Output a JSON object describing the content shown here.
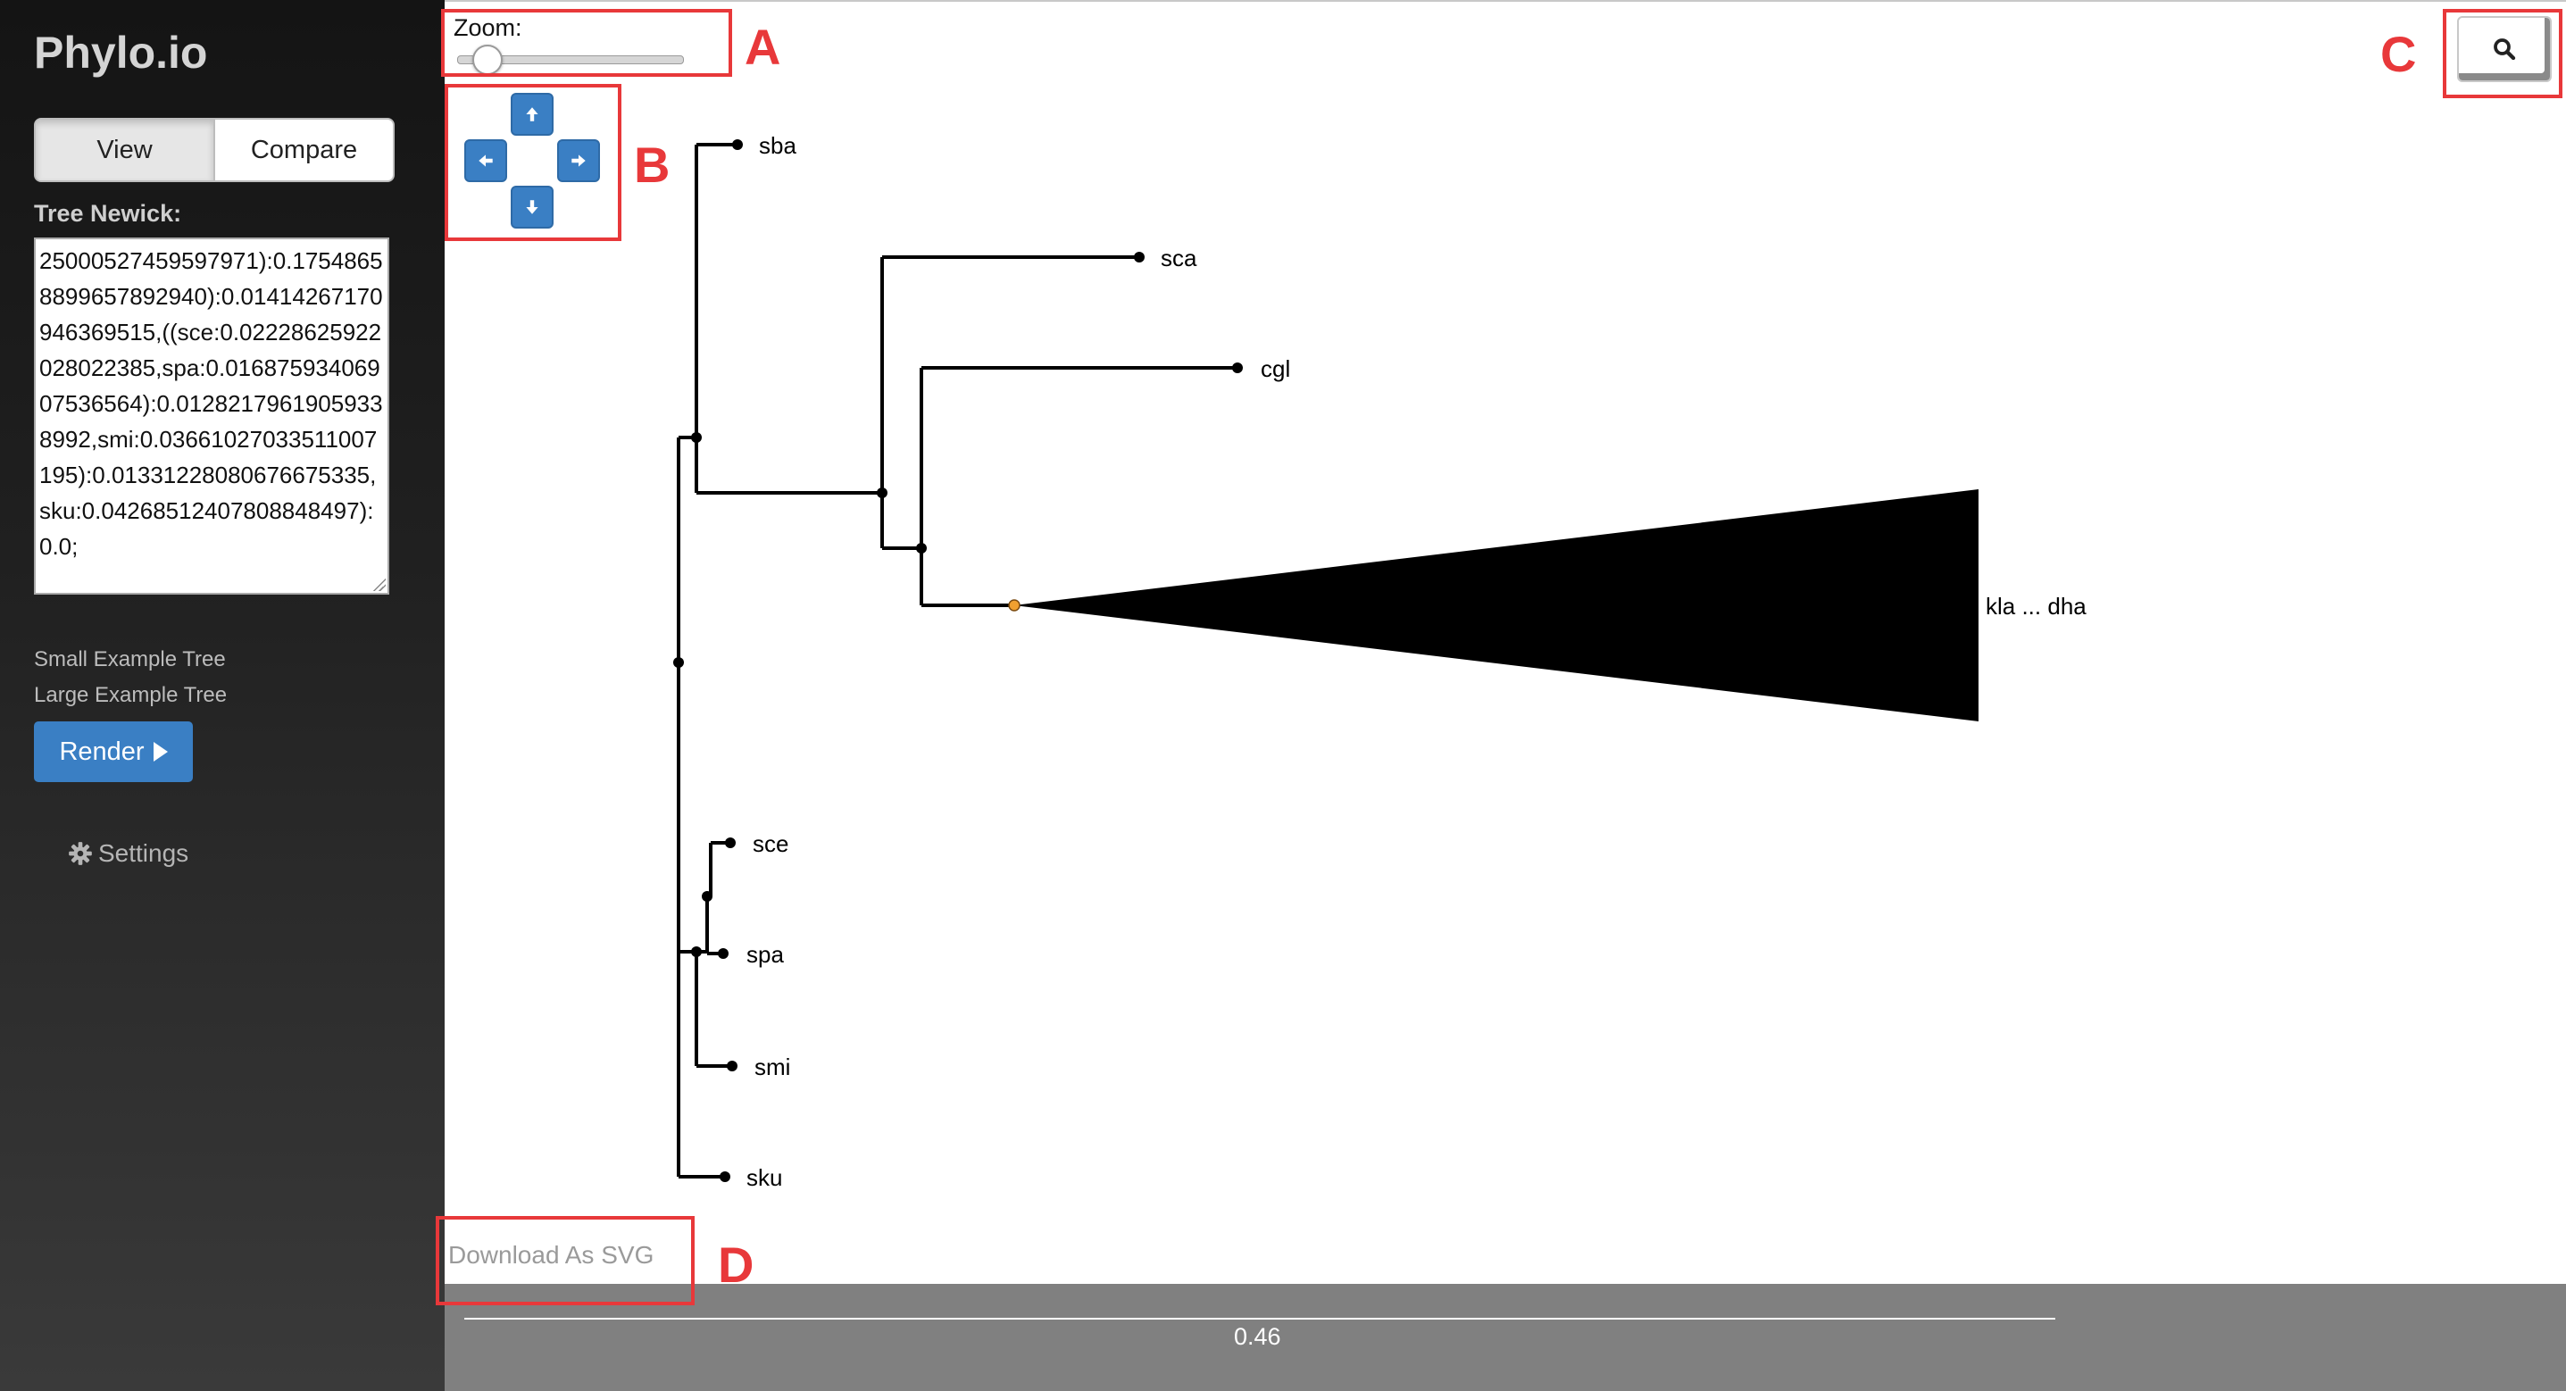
{
  "app": {
    "title": "Phylo.io"
  },
  "mode_toggle": {
    "view_label": "View",
    "compare_label": "Compare",
    "active": "View"
  },
  "newick": {
    "label": "Tree Newick:",
    "value": "25000527459597971):0.17548658899657892940):0.01414267170946369515,((sce:0.02228625922028022385,spa:0.01687593406907536564):0.01282179619059338992,smi:0.03661027033511007195):0.01331228080676675335,sku:0.04268512407808848497):0.0;"
  },
  "examples": {
    "small": "Small Example Tree",
    "large": "Large Example Tree"
  },
  "render_label": "Render",
  "settings_label": "Settings",
  "zoom": {
    "label": "Zoom:",
    "level": 0.12
  },
  "tree": {
    "leaves": [
      "sba",
      "sca",
      "cgl",
      "sce",
      "spa",
      "smi",
      "sku"
    ],
    "collapsed_label": "kla ... dha"
  },
  "download_label": "Download As SVG",
  "scale_value": "0.46",
  "annotations": [
    "A",
    "B",
    "C",
    "D"
  ],
  "colors": {
    "accent": "#3a7fc4",
    "annotation": "#e8383a",
    "footer": "#808080",
    "sidebar": "#1c1c1c"
  },
  "icons": [
    "arrow-up-icon",
    "arrow-left-icon",
    "arrow-right-icon",
    "arrow-down-icon",
    "search-icon",
    "gear-icon",
    "play-icon"
  ]
}
